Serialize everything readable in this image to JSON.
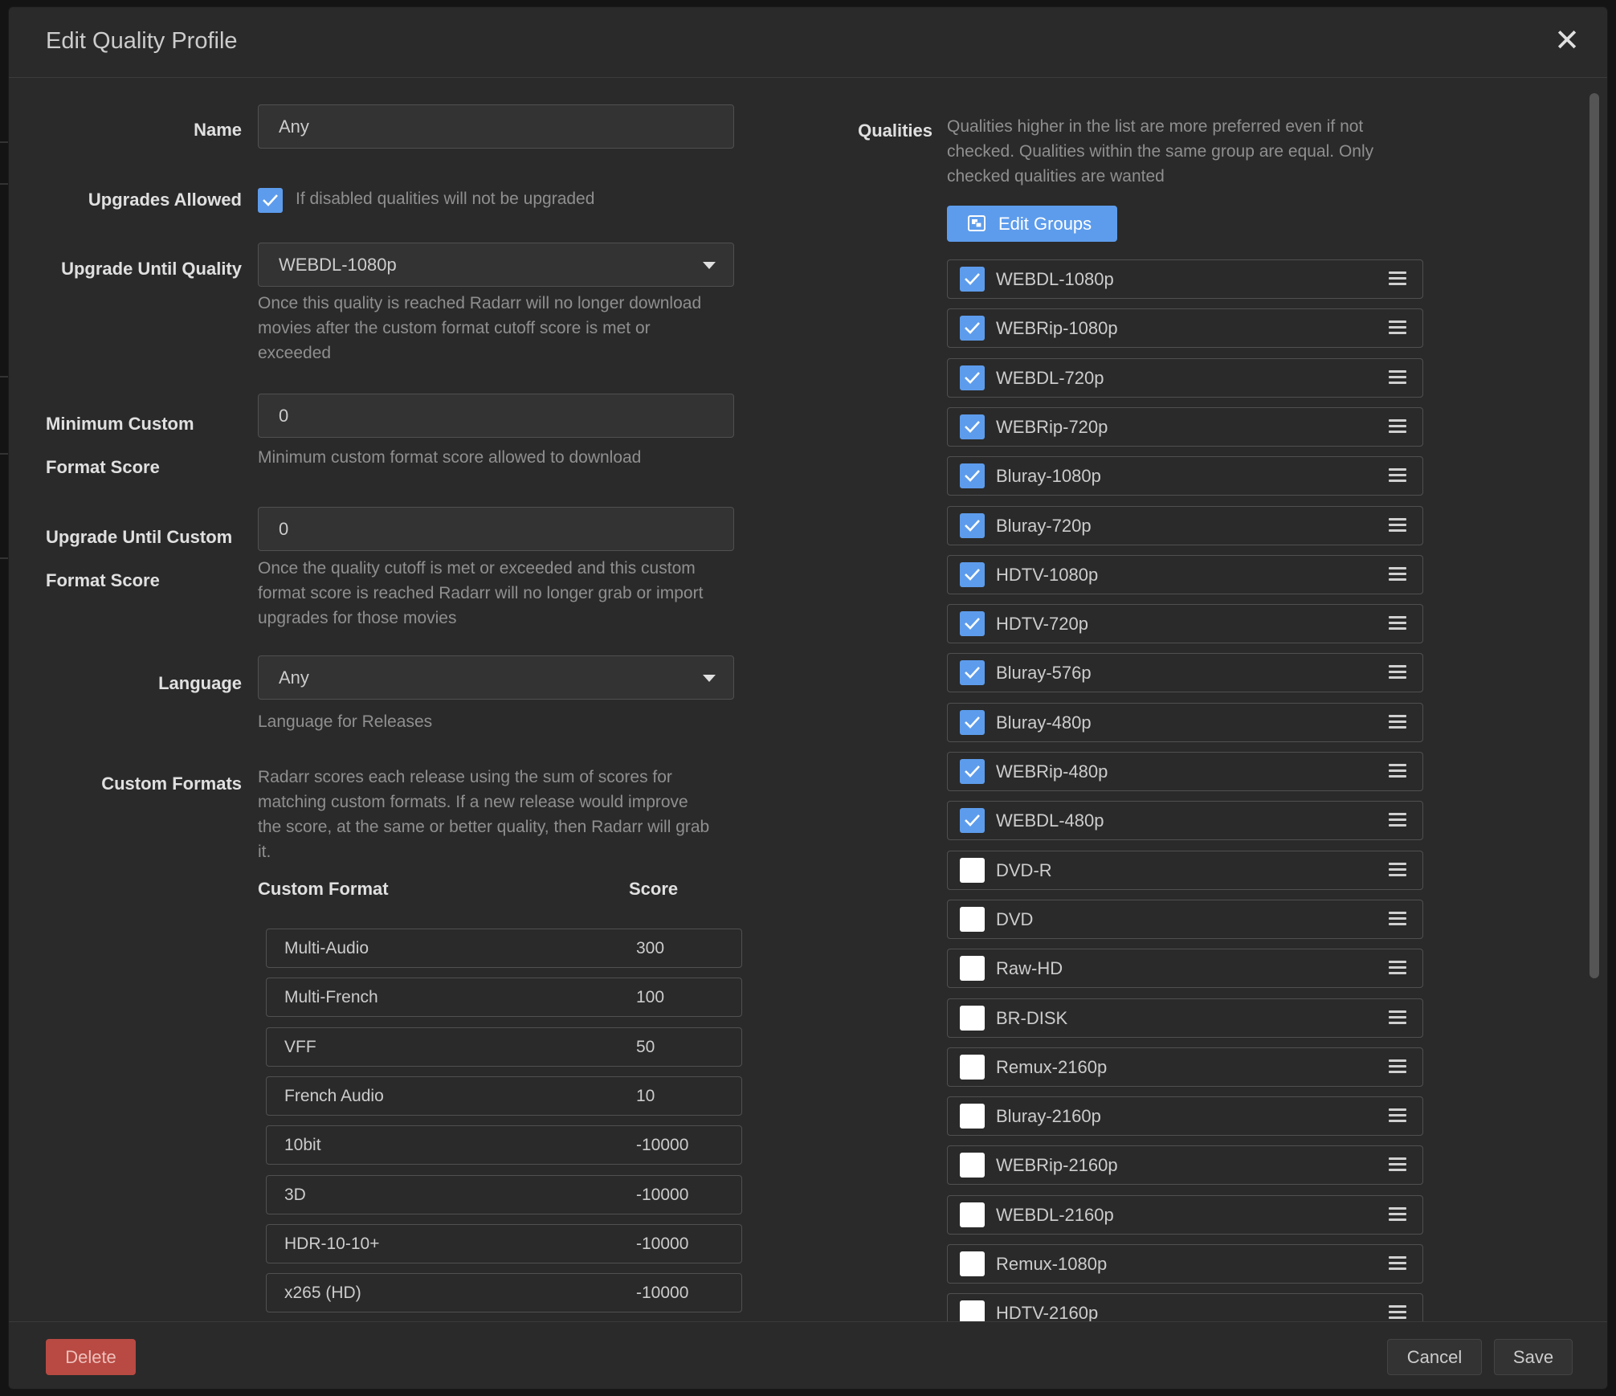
{
  "modal": {
    "title": "Edit Quality Profile"
  },
  "form": {
    "name_label": "Name",
    "name_value": "Any",
    "upgrades_allowed_label": "Upgrades Allowed",
    "upgrades_allowed_help": "If disabled qualities will not be upgraded",
    "upgrade_until_quality_label": "Upgrade Until Quality",
    "upgrade_until_quality_value": "WEBDL-1080p",
    "upgrade_until_quality_help": [
      "Once this quality is reached Radarr will no longer download",
      "movies after the custom format cutoff score is met or",
      "exceeded"
    ],
    "min_cf_score_label": [
      "Minimum Custom",
      "Format Score"
    ],
    "min_cf_score_value": "0",
    "min_cf_score_help": "Minimum custom format score allowed to download",
    "upgrade_until_cf_score_label": [
      "Upgrade Until Custom",
      "Format Score"
    ],
    "upgrade_until_cf_score_value": "0",
    "upgrade_until_cf_score_help": [
      "Once the quality cutoff is met or exceeded and this custom",
      "format score is reached Radarr will no longer grab or import",
      "upgrades for those movies"
    ],
    "language_label": "Language",
    "language_value": "Any",
    "language_help": "Language for Releases",
    "custom_formats_label": "Custom Formats",
    "custom_formats_help": [
      "Radarr scores each release using the sum of scores for",
      "matching custom formats. If a new release would improve",
      "the score, at the same or better quality, then Radarr will grab",
      "it."
    ],
    "cf_table_headers": {
      "format": "Custom Format",
      "score": "Score"
    },
    "custom_formats": [
      {
        "name": "Multi-Audio",
        "score": "300"
      },
      {
        "name": "Multi-French",
        "score": "100"
      },
      {
        "name": "VFF",
        "score": "50"
      },
      {
        "name": "French Audio",
        "score": "10"
      },
      {
        "name": "10bit",
        "score": "-10000"
      },
      {
        "name": "3D",
        "score": "-10000"
      },
      {
        "name": "HDR-10-10+",
        "score": "-10000"
      },
      {
        "name": "x265 (HD)",
        "score": "-10000"
      }
    ]
  },
  "qualities": {
    "label": "Qualities",
    "help": [
      "Qualities higher in the list are more preferred even if not",
      "checked. Qualities within the same group are equal. Only",
      "checked qualities are wanted"
    ],
    "edit_groups_label": "Edit Groups",
    "items": [
      {
        "name": "WEBDL-1080p",
        "checked": true
      },
      {
        "name": "WEBRip-1080p",
        "checked": true
      },
      {
        "name": "WEBDL-720p",
        "checked": true
      },
      {
        "name": "WEBRip-720p",
        "checked": true
      },
      {
        "name": "Bluray-1080p",
        "checked": true
      },
      {
        "name": "Bluray-720p",
        "checked": true
      },
      {
        "name": "HDTV-1080p",
        "checked": true
      },
      {
        "name": "HDTV-720p",
        "checked": true
      },
      {
        "name": "Bluray-576p",
        "checked": true
      },
      {
        "name": "Bluray-480p",
        "checked": true
      },
      {
        "name": "WEBRip-480p",
        "checked": true
      },
      {
        "name": "WEBDL-480p",
        "checked": true
      },
      {
        "name": "DVD-R",
        "checked": false
      },
      {
        "name": "DVD",
        "checked": false
      },
      {
        "name": "Raw-HD",
        "checked": false
      },
      {
        "name": "BR-DISK",
        "checked": false
      },
      {
        "name": "Remux-2160p",
        "checked": false
      },
      {
        "name": "Bluray-2160p",
        "checked": false
      },
      {
        "name": "WEBRip-2160p",
        "checked": false
      },
      {
        "name": "WEBDL-2160p",
        "checked": false
      },
      {
        "name": "Remux-1080p",
        "checked": false
      },
      {
        "name": "HDTV-2160p",
        "checked": false
      }
    ]
  },
  "footer": {
    "delete_label": "Delete",
    "cancel_label": "Cancel",
    "save_label": "Save"
  },
  "colors": {
    "accent": "#5d9cec",
    "danger": "#b84a43",
    "background": "#2a2a2a"
  }
}
